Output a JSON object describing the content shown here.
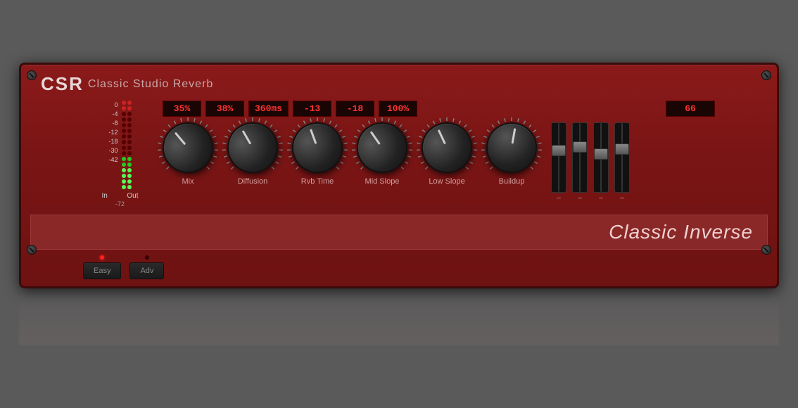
{
  "plugin": {
    "brand_abbr": "CSR",
    "brand_full": "Classic Studio Reverb",
    "preset_name": "Classic Inverse"
  },
  "displays": {
    "mix": "35%",
    "diffusion": "38%",
    "rvb_time": "360ms",
    "mid_slope": "-13",
    "low_slope": "-18",
    "buildup": "100%",
    "fader_val": "66"
  },
  "knobs": [
    {
      "id": "mix",
      "label": "Mix",
      "angle": -40
    },
    {
      "id": "diffusion",
      "label": "Diffusion",
      "angle": -30
    },
    {
      "id": "rvb_time",
      "label": "Rvb Time",
      "angle": -20
    },
    {
      "id": "mid_slope",
      "label": "Mid Slope",
      "angle": -35
    },
    {
      "id": "low_slope",
      "label": "Low Slope",
      "angle": -25
    },
    {
      "id": "buildup",
      "label": "Buildup",
      "angle": 10
    }
  ],
  "faders": [
    {
      "id": "f1",
      "pos": 40,
      "label": "-"
    },
    {
      "id": "f2",
      "pos": 35,
      "label": "-"
    },
    {
      "id": "f3",
      "pos": 45,
      "label": "-"
    },
    {
      "id": "f4",
      "pos": 38,
      "label": "-"
    }
  ],
  "vu": {
    "in_label": "In",
    "out_label": "Out",
    "db_labels": [
      "0",
      "-4",
      "-8",
      "-12",
      "-18",
      "-30",
      "-42"
    ],
    "db_bottom": "-72"
  },
  "buttons": [
    {
      "id": "easy",
      "label": "Easy"
    },
    {
      "id": "adv",
      "label": "Adv"
    }
  ]
}
